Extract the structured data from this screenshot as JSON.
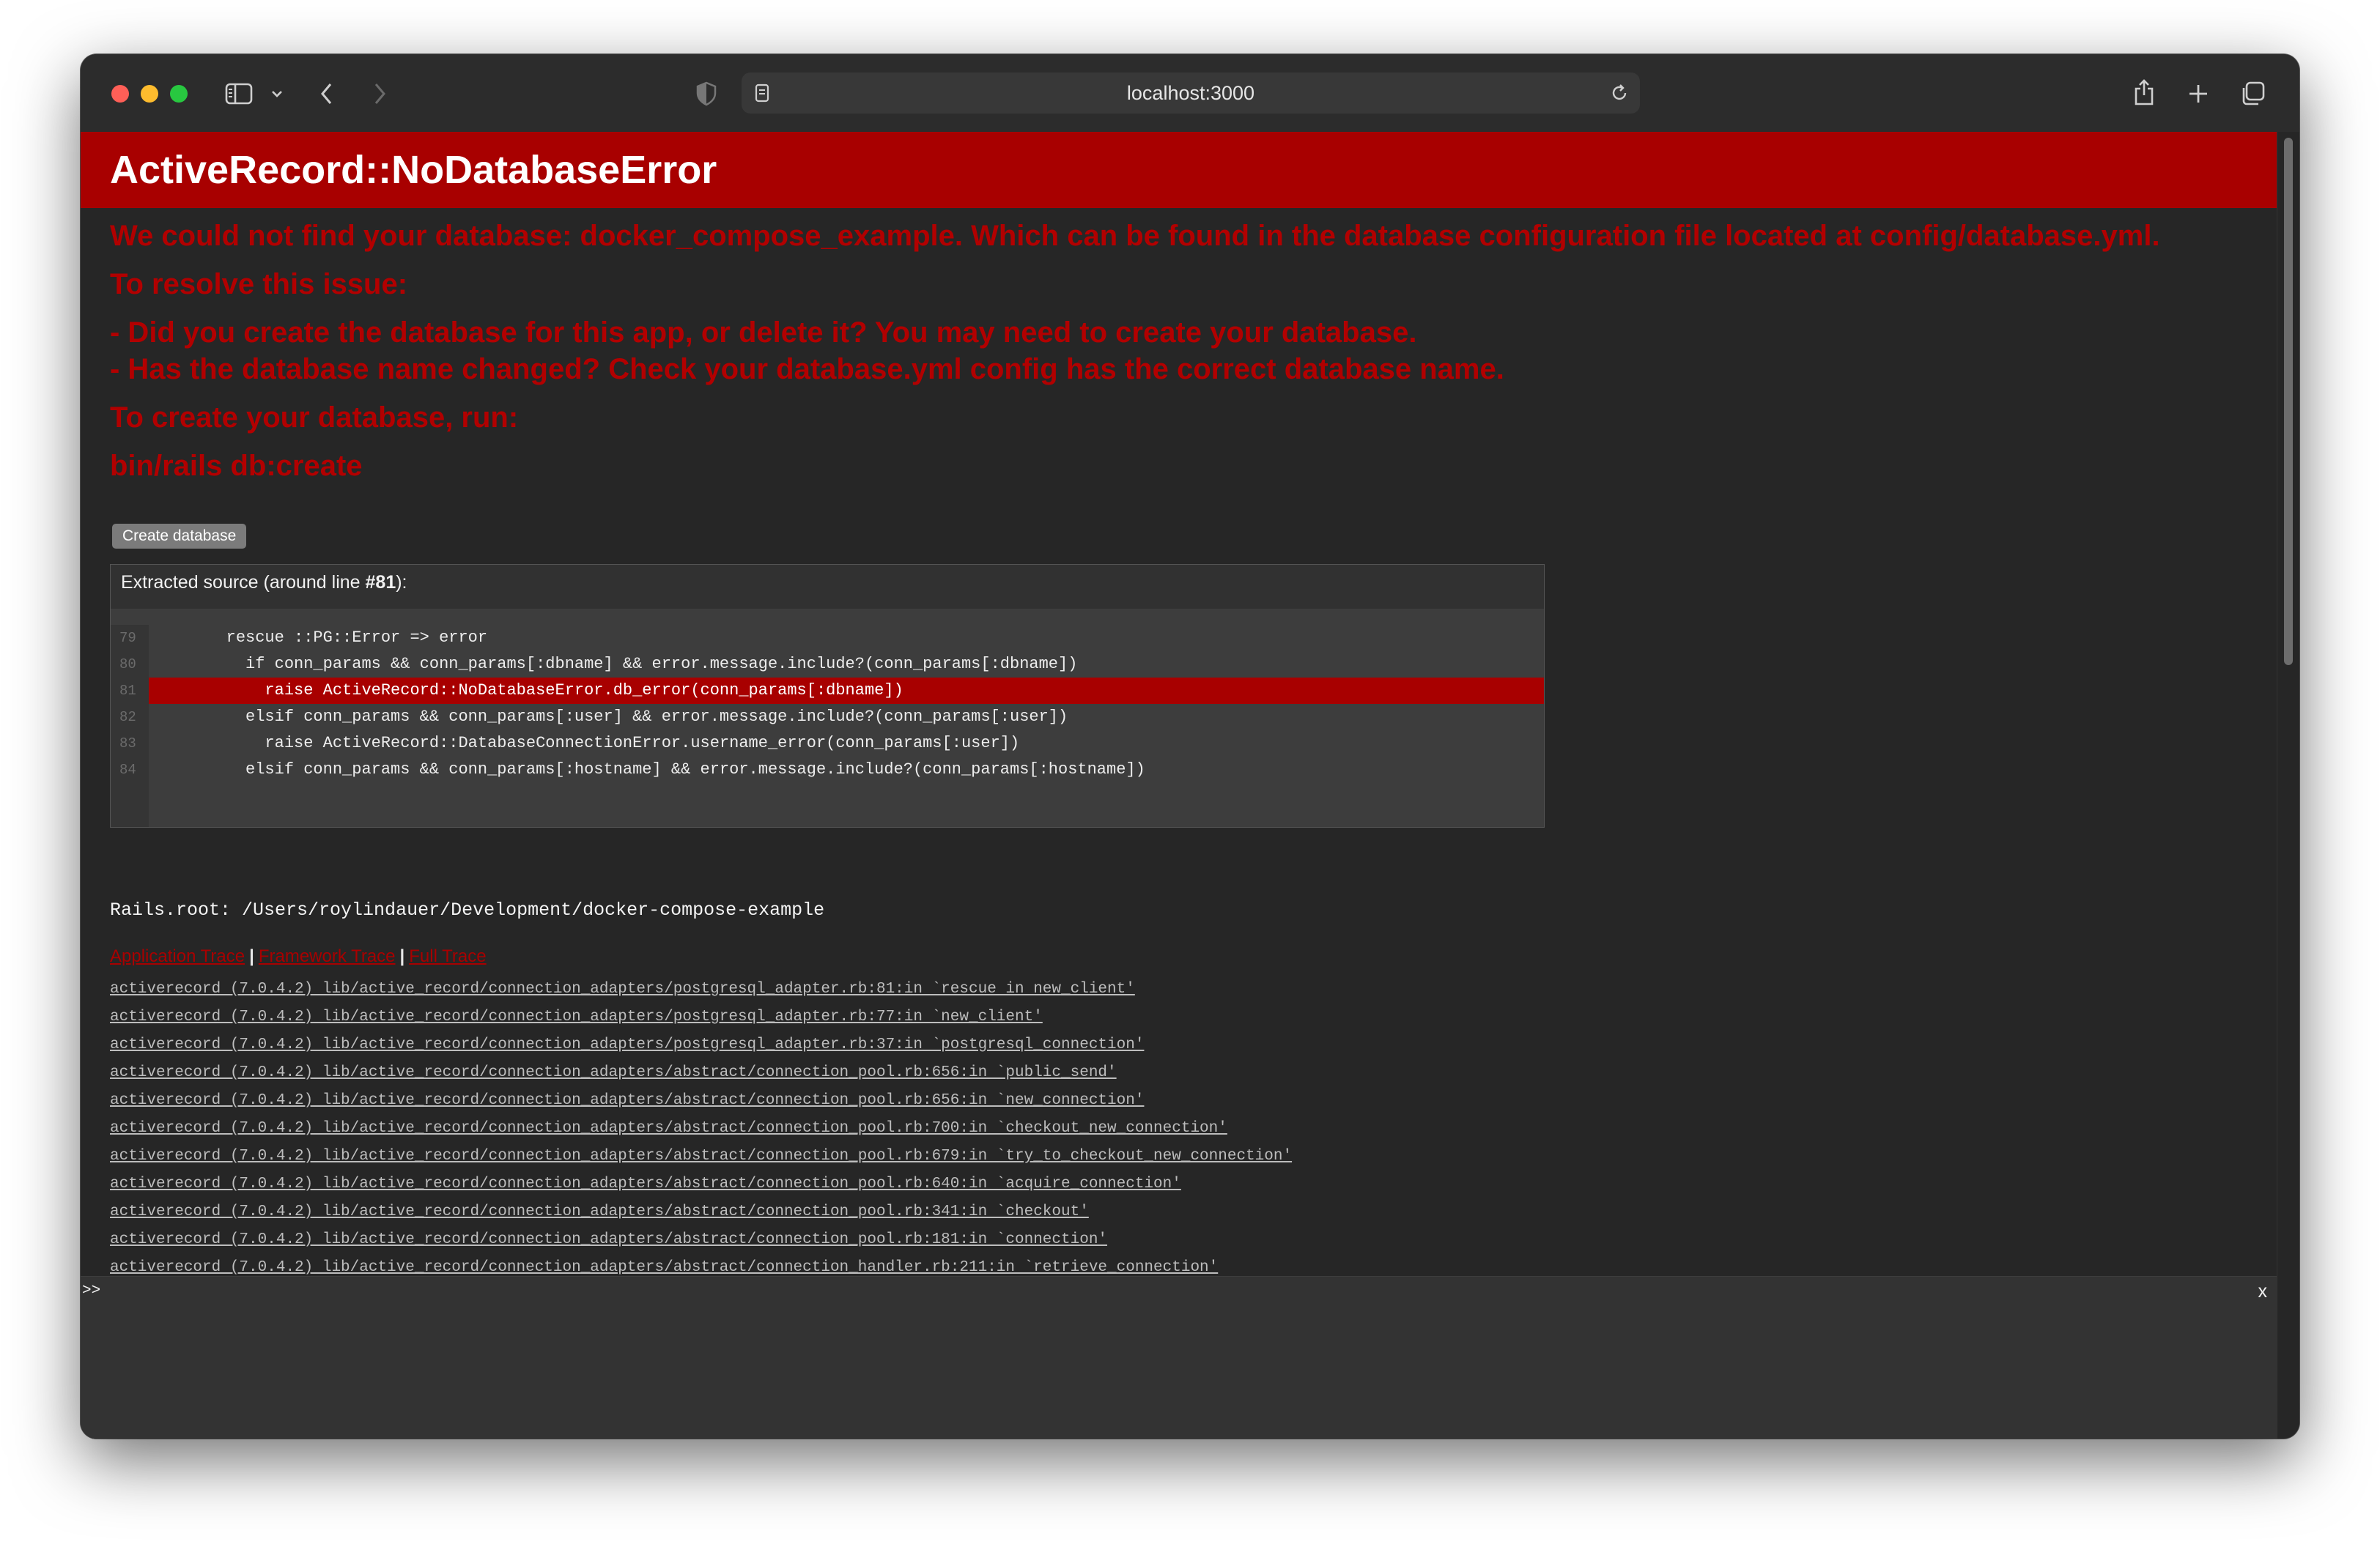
{
  "browser": {
    "address": "localhost:3000"
  },
  "error": {
    "title": "ActiveRecord::NoDatabaseError",
    "message": "We could not find your database: docker_compose_example. Which can be found in the database configuration file located at config/database.yml.",
    "resolve_heading": "To resolve this issue:",
    "resolve_items": [
      "- Did you create the database for this app, or delete it? You may need to create your database.",
      "- Has the database name changed? Check your database.yml config has the correct database name."
    ],
    "create_heading": "To create your database, run:",
    "command": "bin/rails db:create",
    "create_button": "Create database"
  },
  "source": {
    "title_prefix": "Extracted source (around line ",
    "title_line": "#81",
    "title_suffix": "):",
    "lines": [
      {
        "num": "79",
        "code": "        rescue ::PG::Error => error"
      },
      {
        "num": "80",
        "code": "          if conn_params && conn_params[:dbname] && error.message.include?(conn_params[:dbname])"
      },
      {
        "num": "81",
        "code": "            raise ActiveRecord::NoDatabaseError.db_error(conn_params[:dbname])"
      },
      {
        "num": "82",
        "code": "          elsif conn_params && conn_params[:user] && error.message.include?(conn_params[:user])"
      },
      {
        "num": "83",
        "code": "            raise ActiveRecord::DatabaseConnectionError.username_error(conn_params[:user])"
      },
      {
        "num": "84",
        "code": "          elsif conn_params && conn_params[:hostname] && error.message.include?(conn_params[:hostname])"
      }
    ]
  },
  "rails_root": "Rails.root: /Users/roylindauer/Development/docker-compose-example",
  "trace": {
    "tabs": [
      "Application Trace",
      "Framework Trace",
      "Full Trace"
    ],
    "separator": "|",
    "items": [
      "activerecord (7.0.4.2) lib/active_record/connection_adapters/postgresql_adapter.rb:81:in `rescue in new_client'",
      "activerecord (7.0.4.2) lib/active_record/connection_adapters/postgresql_adapter.rb:77:in `new_client'",
      "activerecord (7.0.4.2) lib/active_record/connection_adapters/postgresql_adapter.rb:37:in `postgresql_connection'",
      "activerecord (7.0.4.2) lib/active_record/connection_adapters/abstract/connection_pool.rb:656:in `public_send'",
      "activerecord (7.0.4.2) lib/active_record/connection_adapters/abstract/connection_pool.rb:656:in `new_connection'",
      "activerecord (7.0.4.2) lib/active_record/connection_adapters/abstract/connection_pool.rb:700:in `checkout_new_connection'",
      "activerecord (7.0.4.2) lib/active_record/connection_adapters/abstract/connection_pool.rb:679:in `try_to_checkout_new_connection'",
      "activerecord (7.0.4.2) lib/active_record/connection_adapters/abstract/connection_pool.rb:640:in `acquire_connection'",
      "activerecord (7.0.4.2) lib/active_record/connection_adapters/abstract/connection_pool.rb:341:in `checkout'",
      "activerecord (7.0.4.2) lib/active_record/connection_adapters/abstract/connection_pool.rb:181:in `connection'",
      "activerecord (7.0.4.2) lib/active_record/connection_adapters/abstract/connection_handler.rb:211:in `retrieve_connection'"
    ]
  },
  "console": {
    "prompt": ">>",
    "close": "x"
  }
}
